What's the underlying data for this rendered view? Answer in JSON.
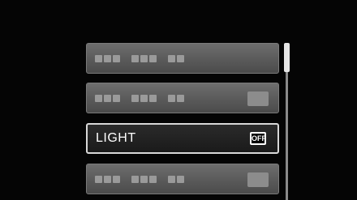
{
  "menu": {
    "items": [
      {
        "label": "",
        "value": ""
      },
      {
        "label": "",
        "value": ""
      },
      {
        "label": "LIGHT",
        "value": "OFF"
      },
      {
        "label": "",
        "value": ""
      }
    ],
    "selected_index": 2
  },
  "colors": {
    "selected_border": "#d8d8d8",
    "item_bg": "#5a5a5a",
    "background": "#050505"
  }
}
